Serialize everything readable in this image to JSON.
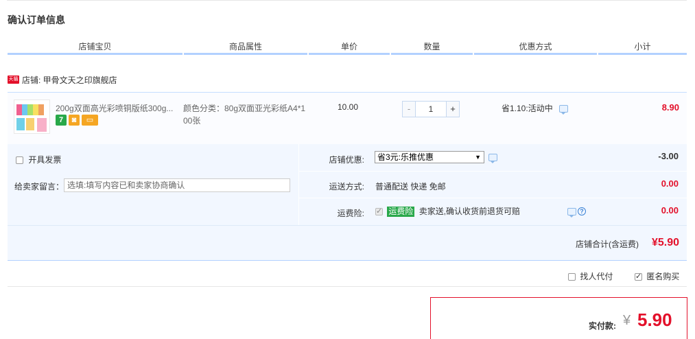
{
  "page_title": "确认订单信息",
  "columns": [
    "店铺宝贝",
    "商品属性",
    "单价",
    "数量",
    "优惠方式",
    "小计"
  ],
  "shop": {
    "badge": "天猫",
    "label": "店铺: 甲骨文天之印旗舰店"
  },
  "item": {
    "title": "200g双面高光彩喷铜版纸300g...",
    "sku": "颜色分类：80g双面亚光彩纸A4*100张",
    "price": "10.00",
    "quantity": "1",
    "minus": "-",
    "plus": "+",
    "discount": "省1.10:活动中",
    "subtotal": "8.90",
    "badges": [
      {
        "icon": "seven-day-return-icon",
        "glyph": "7",
        "color": "#28a84a"
      },
      {
        "icon": "shopping-bag-icon",
        "glyph": "◙",
        "color": "#f5a623"
      },
      {
        "icon": "card-payment-icon",
        "glyph": "▭",
        "color": "#f5a623"
      }
    ]
  },
  "options": {
    "invoice_label": "开具发票",
    "message_label": "给卖家留言：",
    "message_placeholder": "选填:填写内容已和卖家协商确认",
    "shop_discount_label": "店铺优惠:",
    "shop_discount_value": "省3元:乐推优惠",
    "shop_discount_amount": "-3.00",
    "delivery_label": "运送方式:",
    "delivery_value": "普通配送 快递 免邮",
    "delivery_amount": "0.00",
    "insurance_label": "运费险:",
    "insurance_badge": "运费险",
    "insurance_value": "卖家送,确认收货前退货可赔",
    "insurance_amount": "0.00",
    "help": "?"
  },
  "total": {
    "label": "店铺合计(含运费)",
    "amount": "¥5.90"
  },
  "extras": {
    "proxy_pay": "找人代付",
    "anonymous": "匿名购买"
  },
  "payment": {
    "label": "实付款:",
    "yen": "¥",
    "amount": "5.90"
  },
  "colors": {
    "accent_red": "#e3102a",
    "header_line": "#b2d1ff",
    "panel_bg": "#f2f7ff"
  }
}
